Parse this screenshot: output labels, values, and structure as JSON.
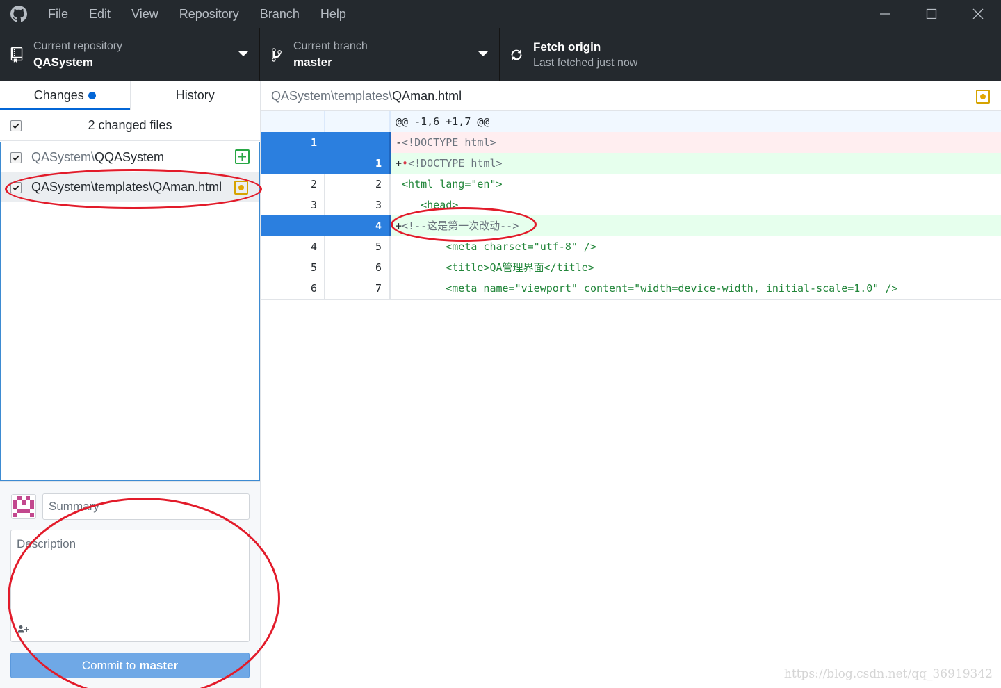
{
  "menu": {
    "file": {
      "acc": "F",
      "rest": "ile"
    },
    "edit": {
      "acc": "E",
      "rest": "dit"
    },
    "view": {
      "acc": "V",
      "rest": "iew"
    },
    "repository": {
      "acc": "R",
      "rest": "epository"
    },
    "branch": {
      "acc": "B",
      "rest": "ranch"
    },
    "help": {
      "acc": "H",
      "rest": "elp"
    }
  },
  "toolbar": {
    "repo_label": "Current repository",
    "repo_value": "QASystem",
    "branch_label": "Current branch",
    "branch_value": "master",
    "fetch_title": "Fetch origin",
    "fetch_sub": "Last fetched just now"
  },
  "sidebar": {
    "tab_changes": "Changes",
    "tab_history": "History",
    "changed_count": "2 changed files",
    "files": [
      {
        "dir": "QASystem\\",
        "name": "QQASystem",
        "status": "added"
      },
      {
        "dir": "QASystem\\templates\\",
        "name": "QAman.html",
        "status": "modified"
      }
    ]
  },
  "commit": {
    "summary_placeholder": "Summary",
    "description_placeholder": "Description",
    "button_prefix": "Commit to",
    "button_branch": "master"
  },
  "diff": {
    "header_dir": "QASystem\\templates\\",
    "header_file": "QAman.html",
    "hunk": "@@ -1,6 +1,7 @@",
    "lines": [
      {
        "old": "1",
        "new": "",
        "prefix": "-",
        "text": "<!DOCTYPE html>",
        "type": "del"
      },
      {
        "old": "",
        "new": "1",
        "prefix": "+",
        "text": "<!DOCTYPE html>",
        "type": "add"
      },
      {
        "old": "2",
        "new": "2",
        "text": "<html lang=\"en\">",
        "type": "ctx"
      },
      {
        "old": "3",
        "new": "3",
        "text": "<head>",
        "type": "ctx"
      },
      {
        "old": "",
        "new": "4",
        "prefix": "+",
        "text": "<!--这是第一次改动-->",
        "type": "add"
      },
      {
        "old": "4",
        "new": "5",
        "text": "<meta charset=\"utf-8\" />",
        "type": "ctx"
      },
      {
        "old": "5",
        "new": "6",
        "text": "<title>QA管理界面</title>",
        "type": "ctx"
      },
      {
        "old": "6",
        "new": "7",
        "text": "<meta name=\"viewport\" content=\"width=device-width, initial-scale=1.0\" />",
        "type": "ctx"
      }
    ]
  },
  "watermark": "https://blog.csdn.net/qq_36919342",
  "colors": {
    "accent": "#0366d6",
    "annotation": "#e21b2a",
    "added": "#28a745",
    "modified": "#e3a700"
  }
}
